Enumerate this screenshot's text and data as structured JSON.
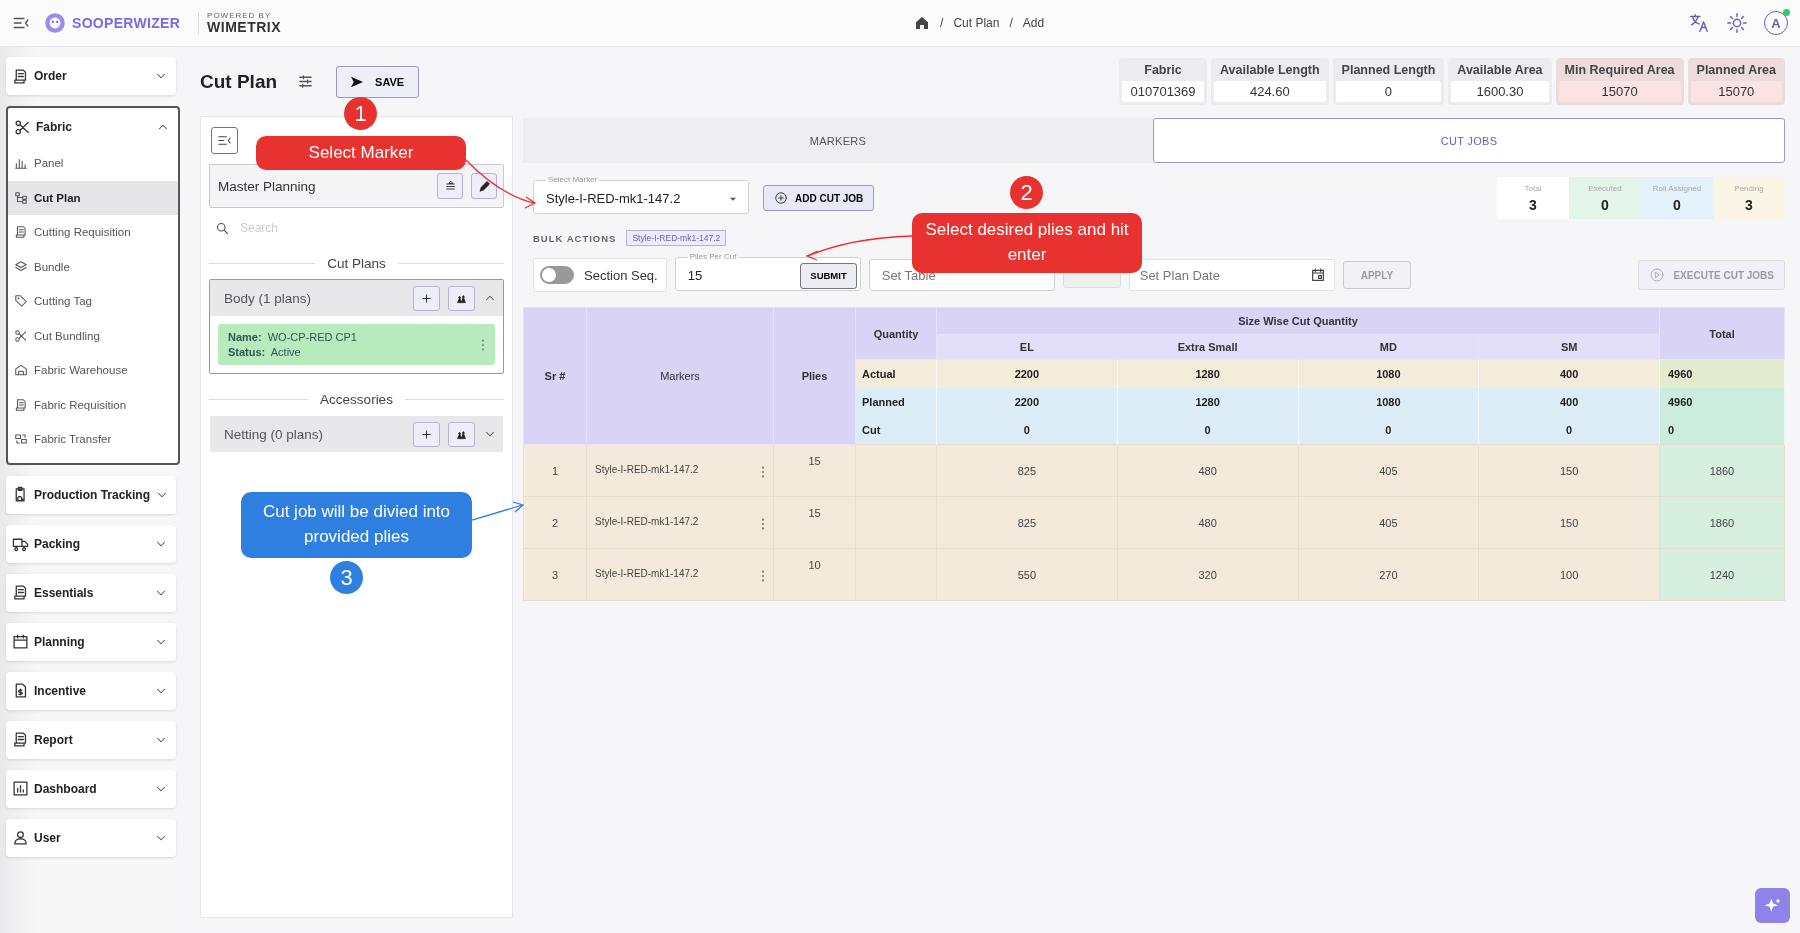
{
  "topbar": {
    "logo": "SOOPERWIZER",
    "powered_by": "POWERED BY",
    "partner": "WIMETRIX",
    "breadcrumb": [
      {
        "separator": "/",
        "label": "Cut Plan"
      },
      {
        "separator": "/",
        "label": "Add"
      }
    ],
    "user_initial": "A",
    "online": true
  },
  "sidebar": [
    {
      "label": "Order",
      "expanded": false
    },
    {
      "label": "Fabric",
      "expanded": true,
      "children": [
        {
          "label": "Panel",
          "selected": false
        },
        {
          "label": "Cut Plan",
          "selected": true
        },
        {
          "label": "Cutting Requisition",
          "selected": false
        },
        {
          "label": "Bundle",
          "selected": false
        },
        {
          "label": "Cutting Tag",
          "selected": false
        },
        {
          "label": "Cut Bundling",
          "selected": false
        },
        {
          "label": "Fabric Warehouse",
          "selected": false
        },
        {
          "label": "Fabric Requisition",
          "selected": false
        },
        {
          "label": "Fabric Transfer",
          "selected": false
        }
      ]
    },
    {
      "label": "Production Tracking",
      "expanded": false
    },
    {
      "label": "Packing",
      "expanded": false
    },
    {
      "label": "Essentials",
      "expanded": false
    },
    {
      "label": "Planning",
      "expanded": false
    },
    {
      "label": "Incentive",
      "expanded": false
    },
    {
      "label": "Report",
      "expanded": false
    },
    {
      "label": "Dashboard",
      "expanded": false
    },
    {
      "label": "User",
      "expanded": false
    }
  ],
  "page": {
    "title": "Cut Plan",
    "save": "SAVE"
  },
  "stats": [
    {
      "label": "Fabric",
      "value": "010701369",
      "warning": false
    },
    {
      "label": "Available Length",
      "value": "424.60",
      "warning": false
    },
    {
      "label": "Planned Length",
      "value": "0",
      "warning": false
    },
    {
      "label": "Available Area",
      "value": "1600.30",
      "warning": false
    },
    {
      "label": "Min Required Area",
      "value": "15070",
      "warning": true
    },
    {
      "label": "Planned Area",
      "value": "15070",
      "warning": true
    }
  ],
  "left_panel": {
    "plan_name": "Master Planning",
    "search_placeholder": "Search",
    "sections": [
      {
        "title": "Cut Plans",
        "groups": [
          {
            "label": "Body (1 plans)",
            "expanded": true,
            "plans": [
              {
                "name_label": "Name:",
                "name": "WO-CP-RED CP1",
                "status_label": "Status:",
                "status": "Active"
              }
            ]
          }
        ]
      },
      {
        "title": "Accessories",
        "groups": [
          {
            "label": "Netting (0 plans)",
            "expanded": false
          }
        ]
      }
    ]
  },
  "tabs": [
    {
      "label": "MARKERS",
      "selected": false
    },
    {
      "label": "CUT JOBS",
      "selected": true
    }
  ],
  "marker_select": {
    "label": "Select Marker",
    "value": "Style-I-RED-mk1-147.2"
  },
  "add_button": "ADD CUT JOB",
  "counts": [
    {
      "label": "Total",
      "value": "3",
      "color": "#ffffff"
    },
    {
      "label": "Executed",
      "value": "0",
      "color": "#e3f4e8"
    },
    {
      "label": "Roll Assigned",
      "value": "0",
      "color": "#e2f1fa"
    },
    {
      "label": "Pending",
      "value": "3",
      "color": "#fbf5e6"
    }
  ],
  "bulk": {
    "label": "BULK ACTIONS",
    "chip": "Style-I-RED-mk1-147.2"
  },
  "controls": {
    "section_seq": {
      "label": "Section Seq.",
      "on": false
    },
    "plies": {
      "label": "Plies Per Cut",
      "value": "15"
    },
    "submit": "SUBMIT",
    "table_placeholder": "Set Table",
    "date_placeholder": "Set Plan Date",
    "apply": {
      "label": "APPLY",
      "disabled": true
    },
    "execute": {
      "label": "EXECUTE CUT JOBS",
      "disabled": true
    }
  },
  "table": {
    "columns": {
      "sr": "Sr #",
      "markers": "Markers",
      "plies": "Plies",
      "quantity": "Quantity",
      "group": "Size Wise Cut Quantity",
      "sizes": [
        "EL",
        "Extra Small",
        "MD",
        "SM"
      ],
      "total": "Total"
    },
    "summary": [
      {
        "kind": "actual",
        "label": "Actual",
        "values": [
          "2200",
          "1280",
          "1080",
          "400"
        ],
        "total": "4960"
      },
      {
        "kind": "planned",
        "label": "Planned",
        "values": [
          "2200",
          "1280",
          "1080",
          "400"
        ],
        "total": "4960"
      },
      {
        "kind": "cut",
        "label": "Cut",
        "values": [
          "0",
          "0",
          "0",
          "0"
        ],
        "total": "0"
      }
    ],
    "rows": [
      {
        "sr": "1",
        "marker": "Style-I-RED-mk1-147.2",
        "plies": "15",
        "values": [
          "825",
          "480",
          "405",
          "150"
        ],
        "total": "1860"
      },
      {
        "sr": "2",
        "marker": "Style-I-RED-mk1-147.2",
        "plies": "15",
        "values": [
          "825",
          "480",
          "405",
          "150"
        ],
        "total": "1860"
      },
      {
        "sr": "3",
        "marker": "Style-I-RED-mk1-147.2",
        "plies": "10",
        "values": [
          "550",
          "320",
          "270",
          "100"
        ],
        "total": "1240"
      }
    ]
  },
  "annotations": [
    {
      "number": "1",
      "text": "Select Marker",
      "color": "#e8322f"
    },
    {
      "number": "2",
      "text": "Select desired plies and hit enter",
      "color": "#e8322f"
    },
    {
      "number": "3",
      "text": "Cut job will be divied into provided plies",
      "color": "#2f7fe0"
    }
  ]
}
